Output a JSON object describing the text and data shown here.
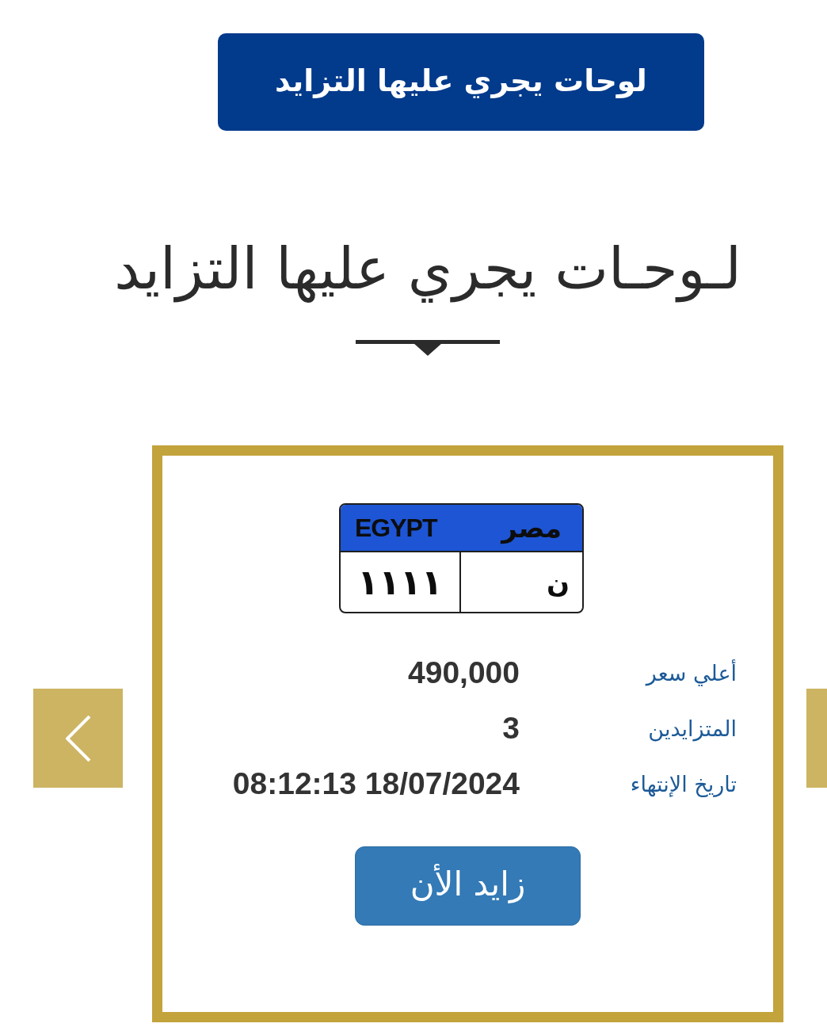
{
  "section_button": {
    "label": "لوحات يجري عليها التزايد"
  },
  "heading": {
    "title": "لـوحـات يجري عليها التزايد"
  },
  "plate": {
    "country_latin": "EGYPT",
    "country_arabic": "مصر",
    "number": "١١١١",
    "letters": "ن"
  },
  "details": [
    {
      "label": "أعلي سعر",
      "value": "490,000"
    },
    {
      "label": "المتزايدين",
      "value": "3"
    },
    {
      "label": "تاريخ الإنتهاء",
      "value": "08:12:13 18/07/2024"
    }
  ],
  "bid_button": {
    "label": "زايد الأن"
  }
}
